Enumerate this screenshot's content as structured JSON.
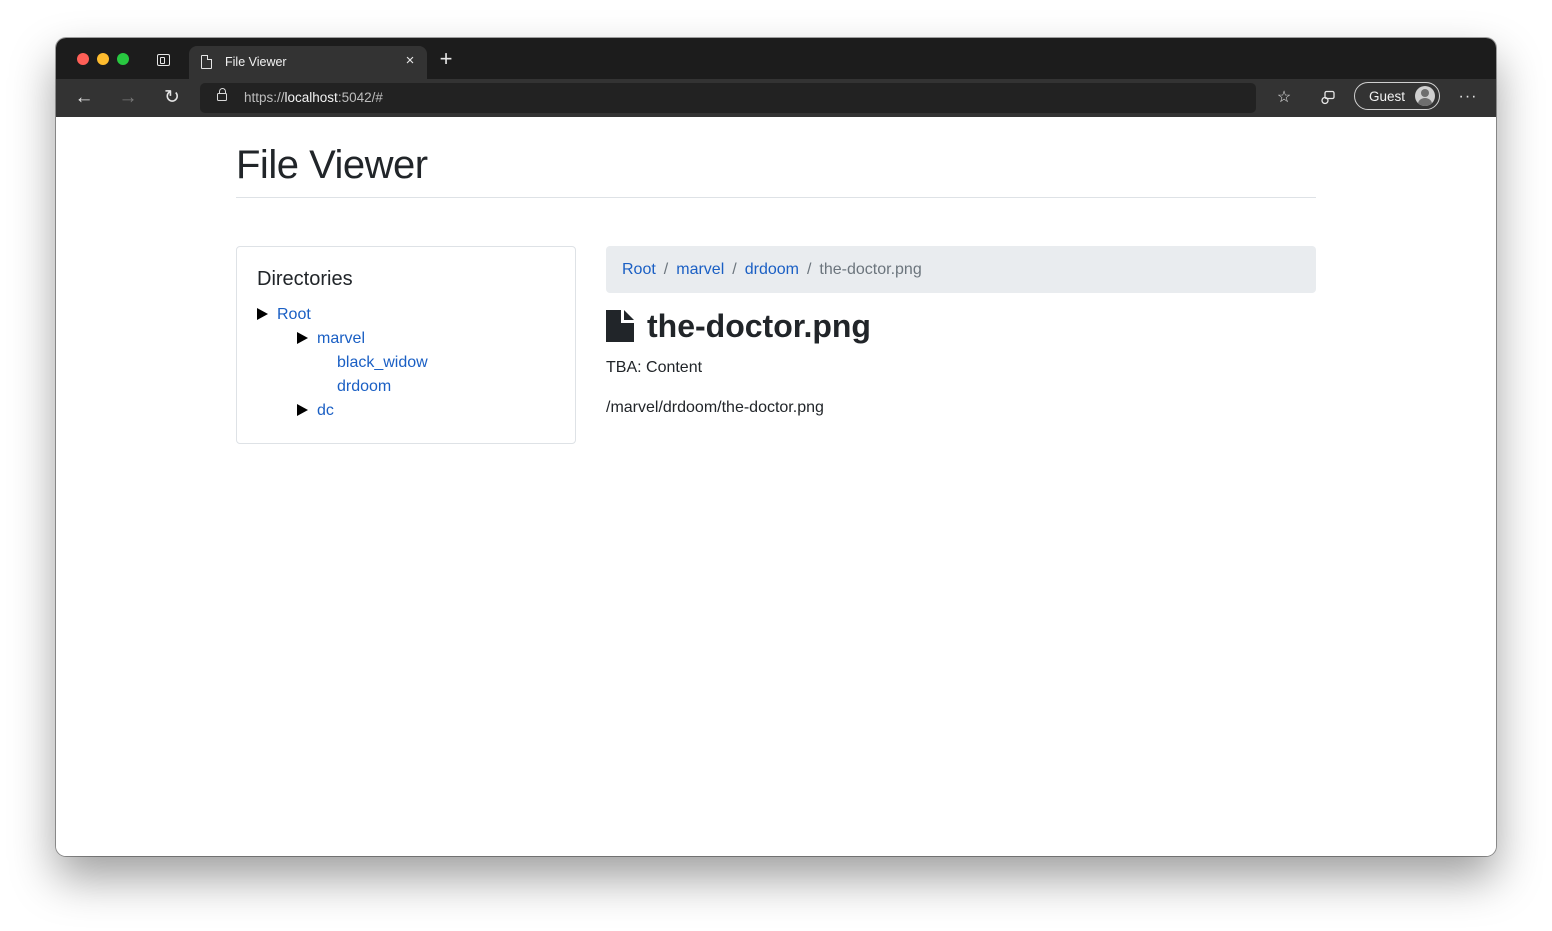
{
  "browser": {
    "tab": {
      "title": "File Viewer",
      "close_glyph": "×"
    },
    "new_tab_glyph": "+",
    "nav": {
      "back_glyph": "←",
      "forward_glyph": "→",
      "reload_glyph": "↻"
    },
    "address": {
      "scheme": "https://",
      "host": "localhost",
      "rest": ":5042/#"
    },
    "toolbar": {
      "favorites_glyph": "☆",
      "profile_label": "Guest",
      "more_glyph": "···"
    }
  },
  "page": {
    "title": "File Viewer",
    "directories": {
      "heading": "Directories",
      "items": [
        {
          "label": "Root",
          "expandable": true,
          "depth": 0
        },
        {
          "label": "marvel",
          "expandable": true,
          "depth": 1
        },
        {
          "label": "black_widow",
          "expandable": false,
          "depth": 2
        },
        {
          "label": "drdoom",
          "expandable": false,
          "depth": 2
        },
        {
          "label": "dc",
          "expandable": true,
          "depth": 1
        }
      ]
    },
    "breadcrumb": {
      "links": [
        "Root",
        "marvel",
        "drdoom"
      ],
      "separator": "/",
      "active": "the-doctor.png"
    },
    "file": {
      "icon": "file-icon",
      "name": "the-doctor.png",
      "content": "TBA: Content",
      "path": "/marvel/drdoom/the-doctor.png"
    }
  },
  "colors": {
    "link": "#1a5fc4",
    "breadcrumb_bg": "#e9ecef",
    "text": "#212529"
  }
}
